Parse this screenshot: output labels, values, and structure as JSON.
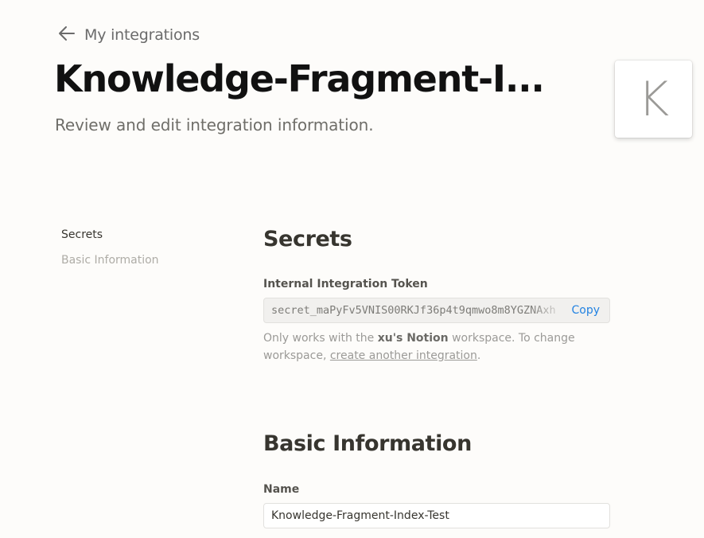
{
  "header": {
    "back_label": "My integrations",
    "title": "Knowledge-Fragment-I...",
    "subtitle": "Review and edit integration information.",
    "avatar_letter": "K"
  },
  "side_nav": {
    "items": [
      {
        "label": "Secrets",
        "active": true
      },
      {
        "label": "Basic Information",
        "active": false
      }
    ]
  },
  "secrets": {
    "heading": "Secrets",
    "token_label": "Internal Integration Token",
    "token_value": "secret_maPyFv5VNIS00RKJf36p4t9qmwo8m8YGZNAxh",
    "copy_label": "Copy",
    "note_prefix": "Only works with the ",
    "note_workspace": "xu's Notion",
    "note_middle": " workspace. To change workspace, ",
    "note_link": "create another integration",
    "note_suffix": "."
  },
  "basic_info": {
    "heading": "Basic Information",
    "name_label": "Name",
    "name_value": "Knowledge-Fragment-Index-Test"
  },
  "colors": {
    "background": "#fdfcfa",
    "title": "#111111",
    "text": "#37352f",
    "muted": "#9b9a97",
    "accent": "#2383e2"
  }
}
